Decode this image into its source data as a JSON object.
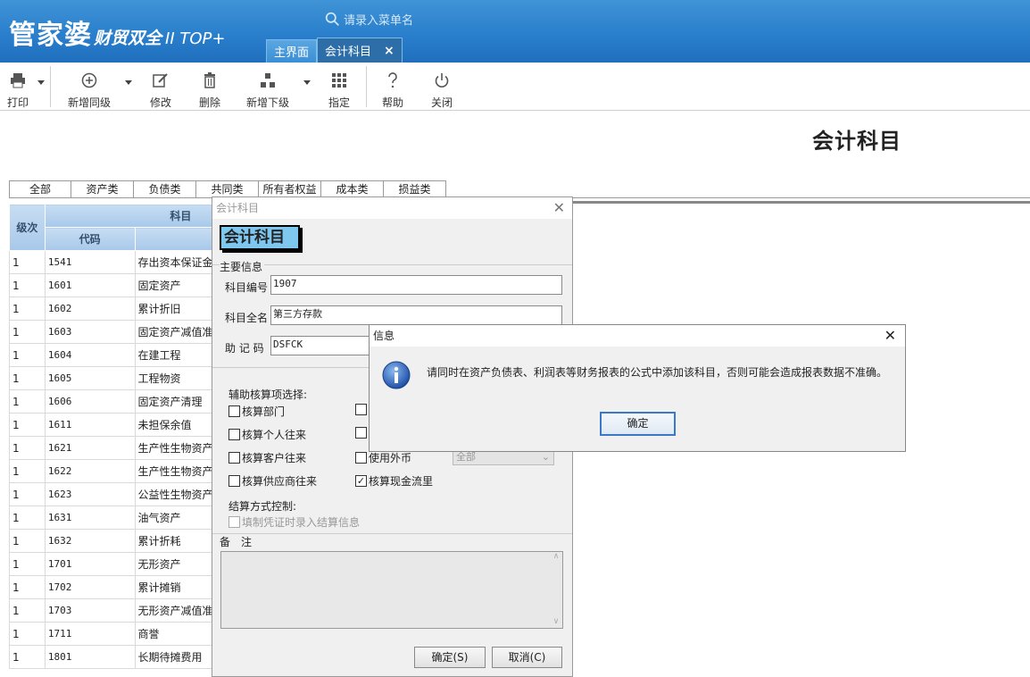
{
  "app": {
    "logo_main": "管家婆",
    "logo_sub": "财贸双全",
    "logo_version": "II TOP+",
    "menu_search_placeholder": "请录入菜单名",
    "tabs": [
      "主界面",
      "会计科目"
    ],
    "tab_close": "×"
  },
  "toolbar": {
    "print": "打印",
    "add_same": "新增同级",
    "edit": "修改",
    "delete": "删除",
    "add_child": "新增下级",
    "assign": "指定",
    "help": "帮助",
    "close": "关闭"
  },
  "page_title": "会计科目",
  "categories": [
    "全部",
    "资产类",
    "负债类",
    "共同类",
    "所有者权益",
    "成本类",
    "损益类"
  ],
  "grid": {
    "col_level": "级次",
    "col_subject": "科目",
    "col_code": "代码",
    "col_name": "名称",
    "rows": [
      {
        "level": "1",
        "code": "1541",
        "name": "存出资本保证金"
      },
      {
        "level": "1",
        "code": "1601",
        "name": "固定资产"
      },
      {
        "level": "1",
        "code": "1602",
        "name": "累计折旧"
      },
      {
        "level": "1",
        "code": "1603",
        "name": "固定资产减值准"
      },
      {
        "level": "1",
        "code": "1604",
        "name": "在建工程"
      },
      {
        "level": "1",
        "code": "1605",
        "name": "工程物资"
      },
      {
        "level": "1",
        "code": "1606",
        "name": "固定资产清理"
      },
      {
        "level": "1",
        "code": "1611",
        "name": "未担保余值"
      },
      {
        "level": "1",
        "code": "1621",
        "name": "生产性生物资产"
      },
      {
        "level": "1",
        "code": "1622",
        "name": "生产性生物资产"
      },
      {
        "level": "1",
        "code": "1623",
        "name": "公益性生物资产"
      },
      {
        "level": "1",
        "code": "1631",
        "name": "油气资产"
      },
      {
        "level": "1",
        "code": "1632",
        "name": "累计折耗"
      },
      {
        "level": "1",
        "code": "1701",
        "name": "无形资产"
      },
      {
        "level": "1",
        "code": "1702",
        "name": "累计摊销"
      },
      {
        "level": "1",
        "code": "1703",
        "name": "无形资产减值准"
      },
      {
        "level": "1",
        "code": "1711",
        "name": "商誉"
      },
      {
        "level": "1",
        "code": "1801",
        "name": "长期待摊费用"
      }
    ]
  },
  "dialog": {
    "title": "会计科目",
    "banner": "会计科目",
    "main_info": "主要信息",
    "code_label": "科目编号",
    "code_value": "1907",
    "name_label": "科目全名",
    "name_value": "第三方存款",
    "mnemonic_label": "助 记 码",
    "mnemonic_value": "DSFCK",
    "aux_label": "辅助核算项选择:",
    "chk_dept": "核算部门",
    "chk_person": "核算个人往来",
    "chk_customer": "核算客户往来",
    "chk_supplier": "核算供应商往来",
    "chk_foreign": "使用外币",
    "foreign_select": "全部",
    "chk_cashflow": "核算现金流里",
    "settle_label": "结算方式控制:",
    "chk_settle": "填制凭证时录入结算信息",
    "memo_label": "备　注",
    "ok": "确定(S)",
    "cancel": "取消(C)"
  },
  "message": {
    "title": "信息",
    "text": "请同时在资产负债表、利润表等财务报表的公式中添加该科目，否则可能会造成报表数据不准确。",
    "ok": "确定"
  },
  "colors": {
    "banner": "#2a7fcc",
    "grid_header": "#b6d3ef",
    "dialog_banner": "#7ec7ee",
    "info_icon": "#2a5fb8"
  }
}
